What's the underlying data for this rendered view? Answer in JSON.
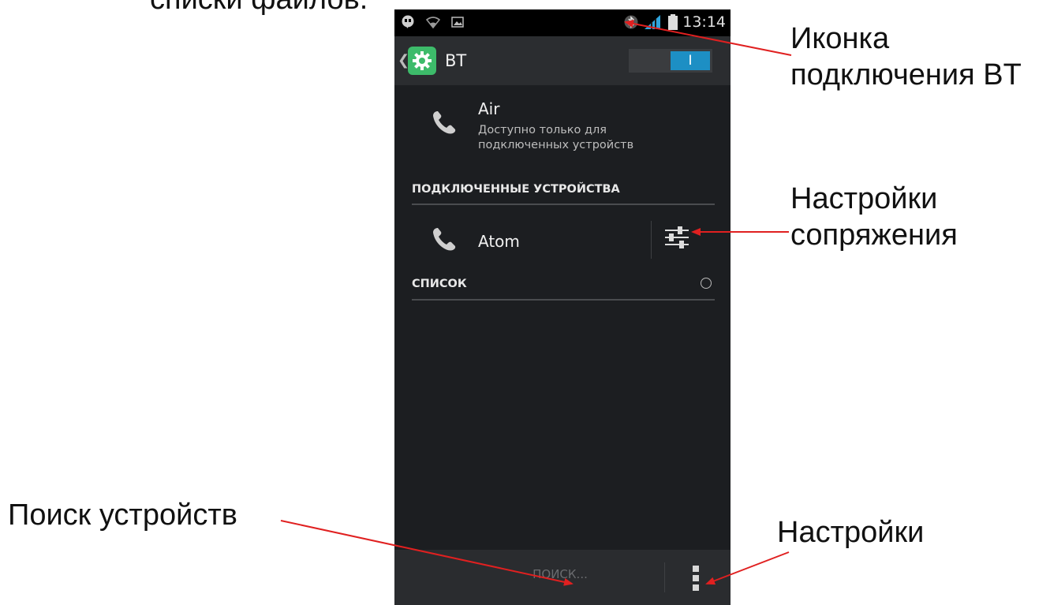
{
  "annotations": {
    "top_cut": "списки файлов.",
    "bt_icon_line1": "Иконка",
    "bt_icon_line2": "подключения BT",
    "pairing_line1": "Настройки",
    "pairing_line2": "сопряжения",
    "search": "Поиск устройств",
    "settings": "Настройки"
  },
  "status_bar": {
    "time": "13:14"
  },
  "action_bar": {
    "title": "BT",
    "toggle_label": "I"
  },
  "device_air": {
    "name": "Air",
    "status_line1": "Доступно только для",
    "status_line2": "подключенных устройств"
  },
  "section_connected": {
    "label": "ПОДКЛЮЧЕННЫЕ УСТРОЙСТВА"
  },
  "device_atom": {
    "name": "Atom"
  },
  "section_list": {
    "label": "СПИСОК"
  },
  "bottom_bar": {
    "search_label": "ПОИСК..."
  },
  "colors": {
    "toggle_on": "#1d8fc4",
    "app_icon": "#3dbb6a",
    "arrow": "#e02020",
    "background": "#1c1e21"
  },
  "icons": [
    "hangouts-icon",
    "wifi-icon",
    "image-notification-icon",
    "bluetooth-icon",
    "signal-icon",
    "battery-icon",
    "settings-gear-icon",
    "phone-icon",
    "pairing-settings-icon",
    "spinner-icon",
    "overflow-menu-icon"
  ]
}
